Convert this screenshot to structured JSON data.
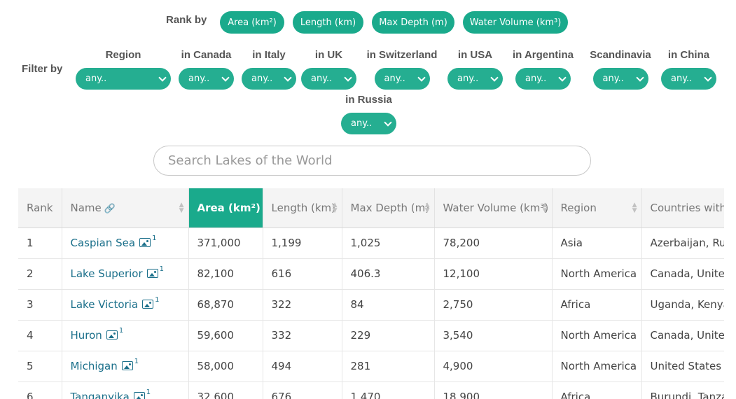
{
  "rank_by": {
    "label": "Rank by",
    "options": [
      "Area (km²)",
      "Length (km)",
      "Max Depth (m)",
      "Water Volume (km³)"
    ]
  },
  "filter_by": {
    "label": "Filter by",
    "filters": [
      {
        "label": "Region",
        "value": "any.."
      },
      {
        "label": "in Canada",
        "value": "any.."
      },
      {
        "label": "in Italy",
        "value": "any.."
      },
      {
        "label": "in UK",
        "value": "any.."
      },
      {
        "label": "in Switzerland",
        "value": "any.."
      },
      {
        "label": "in USA",
        "value": "any.."
      },
      {
        "label": "in Argentina",
        "value": "any.."
      },
      {
        "label": "Scandinavia",
        "value": "any.."
      },
      {
        "label": "in China",
        "value": "any.."
      },
      {
        "label": "in Russia",
        "value": "any.."
      }
    ]
  },
  "search": {
    "placeholder": "Search Lakes of the World"
  },
  "table": {
    "columns": [
      "Rank",
      "Name",
      "Area (km²)",
      "Length (km)",
      "Max Depth (m)",
      "Water Volume (km³)",
      "Region",
      "Countries with"
    ],
    "active_column": "Area (km²)",
    "rows": [
      {
        "rank": "1",
        "name": "Caspian Sea",
        "images": "1",
        "area": "371,000",
        "length": "1,199",
        "depth": "1,025",
        "volume": "78,200",
        "region": "Asia",
        "countries": "Azerbaijan, Rus"
      },
      {
        "rank": "2",
        "name": "Lake Superior",
        "images": "1",
        "area": "82,100",
        "length": "616",
        "depth": "406.3",
        "volume": "12,100",
        "region": "North America",
        "countries": "Canada, United"
      },
      {
        "rank": "3",
        "name": "Lake Victoria",
        "images": "1",
        "area": "68,870",
        "length": "322",
        "depth": "84",
        "volume": "2,750",
        "region": "Africa",
        "countries": "Uganda, Kenya"
      },
      {
        "rank": "4",
        "name": "Huron",
        "images": "1",
        "area": "59,600",
        "length": "332",
        "depth": "229",
        "volume": "3,540",
        "region": "North America",
        "countries": "Canada, United"
      },
      {
        "rank": "5",
        "name": "Michigan",
        "images": "1",
        "area": "58,000",
        "length": "494",
        "depth": "281",
        "volume": "4,900",
        "region": "North America",
        "countries": "United States"
      },
      {
        "rank": "6",
        "name": "Tanganyika",
        "images": "1",
        "area": "32,600",
        "length": "676",
        "depth": "1,470",
        "volume": "18,900",
        "region": "Africa",
        "countries": "Burundi, Tanza"
      }
    ]
  },
  "colors": {
    "accent": "#1aaa8c",
    "link": "#1a6f8a"
  }
}
